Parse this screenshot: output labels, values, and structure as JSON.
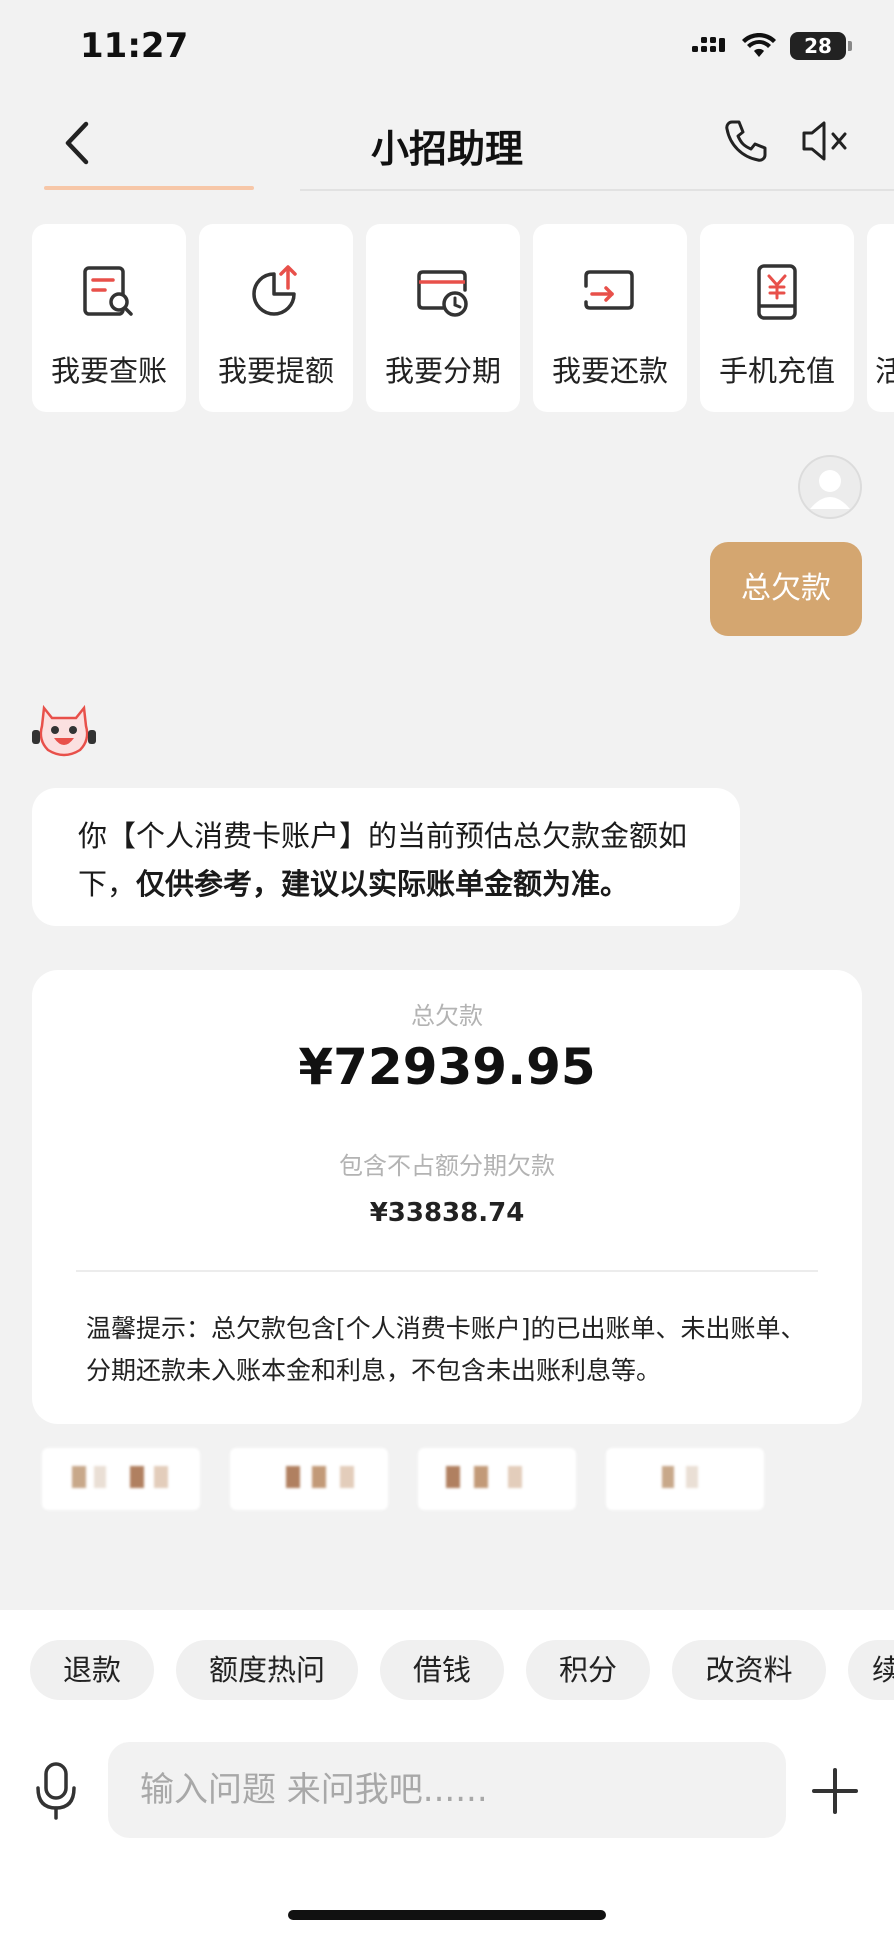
{
  "status_bar": {
    "time": "11:27",
    "battery": "28"
  },
  "nav": {
    "title": "小招助理",
    "icons": [
      "back-icon",
      "phone-icon",
      "mute-icon"
    ]
  },
  "quick_actions": [
    {
      "label": "我要查账",
      "icon": "bill-search-icon"
    },
    {
      "label": "我要提额",
      "icon": "pie-up-icon"
    },
    {
      "label": "我要分期",
      "icon": "card-clock-icon"
    },
    {
      "label": "我要还款",
      "icon": "repay-icon"
    },
    {
      "label": "手机充值",
      "icon": "phone-yen-icon"
    },
    {
      "label": "活",
      "icon": ""
    }
  ],
  "chat": {
    "user_message": "总欠款",
    "bot_message_prefix": "你【个人消费卡账户】的当前预估总欠款金额如下，",
    "bot_message_bold": "仅供参考，建议以实际账单金额为准。"
  },
  "debt_card": {
    "label": "总欠款",
    "amount": "¥72939.95",
    "installment_label": "包含不占额分期欠款",
    "installment_amount": "¥33838.74",
    "tip": "温馨提示：总欠款包含[个人消费卡账户]的已出账单、未出账单、分期还款未入账本金和利息，不包含未出账利息等。"
  },
  "suggestions": [
    "退款",
    "额度热问",
    "借钱",
    "积分",
    "改资料",
    "续"
  ],
  "input": {
    "placeholder": "输入问题 来问我吧......"
  },
  "colors": {
    "accent_orange": "#e8504a",
    "user_bubble": "#d4a670",
    "background": "#f2f2f2"
  }
}
